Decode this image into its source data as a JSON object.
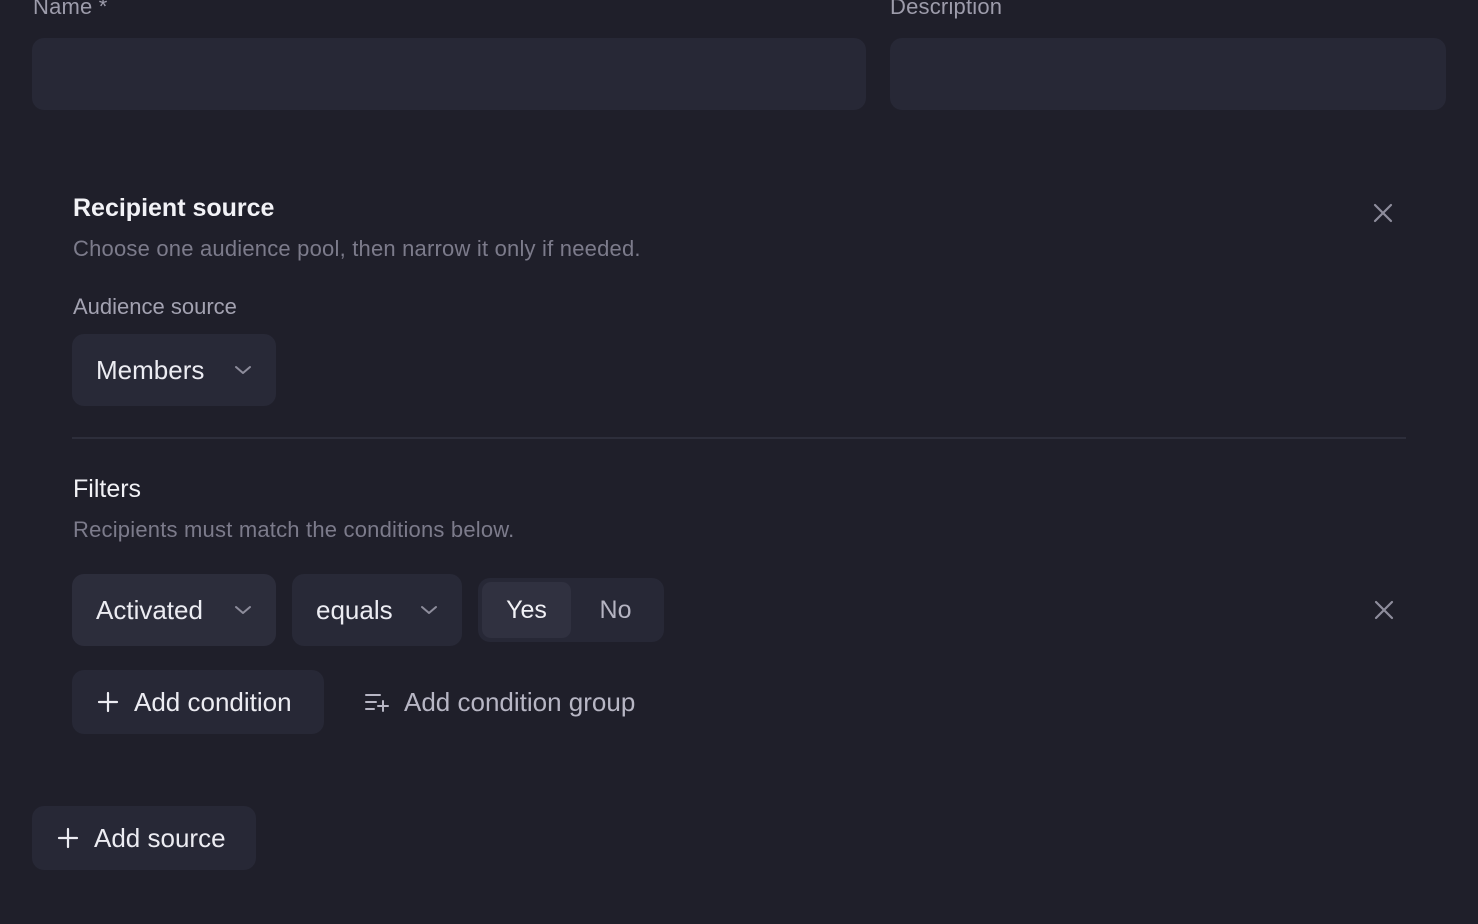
{
  "form": {
    "name_label": "Name *",
    "name_value": "",
    "description_label": "Description",
    "description_value": ""
  },
  "source_card": {
    "title": "Recipient source",
    "subtitle": "Choose one audience pool, then narrow it only if needed.",
    "audience_label": "Audience source",
    "audience_value": "Members",
    "close_icon": "close-icon"
  },
  "filters": {
    "title": "Filters",
    "subtitle": "Recipients must match the conditions below.",
    "conditions": [
      {
        "field": "Activated",
        "operator": "equals",
        "options": [
          "Yes",
          "No"
        ],
        "selected": "Yes"
      }
    ],
    "add_condition_label": "Add condition",
    "add_condition_group_label": "Add condition group"
  },
  "add_source_label": "Add source",
  "icons": {
    "close": "close-icon",
    "chevron": "chevron-down-icon",
    "plus": "plus-icon",
    "list_add": "list-add-icon"
  }
}
